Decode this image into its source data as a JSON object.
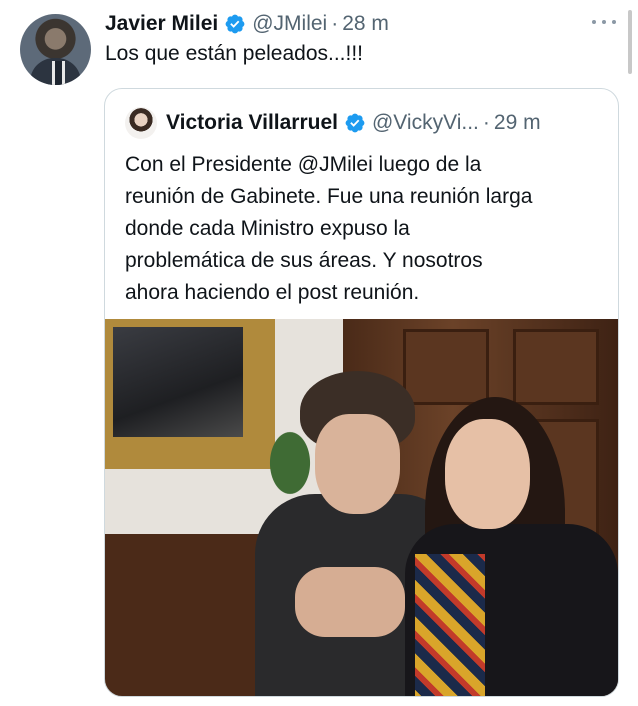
{
  "tweet": {
    "author_name": "Javier Milei",
    "handle": "@JMilei",
    "separator": "·",
    "time": "28 m",
    "text": "Los que están peleados...!!!",
    "verified_color": "#1d9bf0"
  },
  "quoted_tweet": {
    "author_name": "Victoria Villarruel",
    "handle": "@VickyVi...",
    "separator": "·",
    "time": "29 m",
    "text_lines": [
      "Con el Presidente @JMilei luego de la",
      "reunión de Gabinete. Fue una reunión larga",
      "donde cada Ministro expuso la",
      "problemática de sus áreas. Y nosotros",
      "ahora haciendo el post reunión."
    ]
  },
  "icons": {
    "more": "more-icon",
    "verified": "verified-badge-icon"
  }
}
